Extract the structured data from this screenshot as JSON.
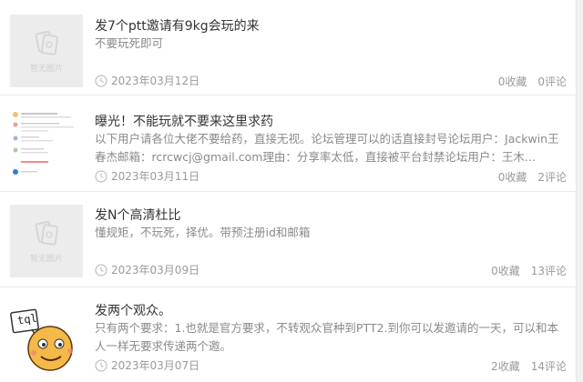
{
  "placeholder_text": "暂无图片",
  "posts": [
    {
      "title": "发7个ptt邀请有9kg会玩的来",
      "desc": "不要玩死即可",
      "date": "2023年03月12日",
      "favorites": "0收藏",
      "comments": "0评论"
    },
    {
      "title": "曝光！不能玩就不要来这里求药",
      "desc": "以下用户请各位大佬不要给药，直接无视。论坛管理可以的话直接封号论坛用户：Jackwin王春杰邮箱：rcrcwcj@gmail.com理由：分享率太低，直接被平台封禁论坛用户：王木...",
      "date": "2023年03月11日",
      "favorites": "0收藏",
      "comments": "2评论"
    },
    {
      "title": "发N个高清杜比",
      "desc": "懂规矩，不玩死，择优。带预注册id和邮箱",
      "date": "2023年03月09日",
      "favorites": "0收藏",
      "comments": "13评论"
    },
    {
      "title": "发两个观众。",
      "desc": "只有两个要求：1.也就是官方要求，不转观众官种到PTT2.到你可以发邀请的一天，可以和本人一样无要求传递两个邀。",
      "date": "2023年03月07日",
      "favorites": "2收藏",
      "comments": "14评论"
    }
  ],
  "sticker_text": "tql"
}
